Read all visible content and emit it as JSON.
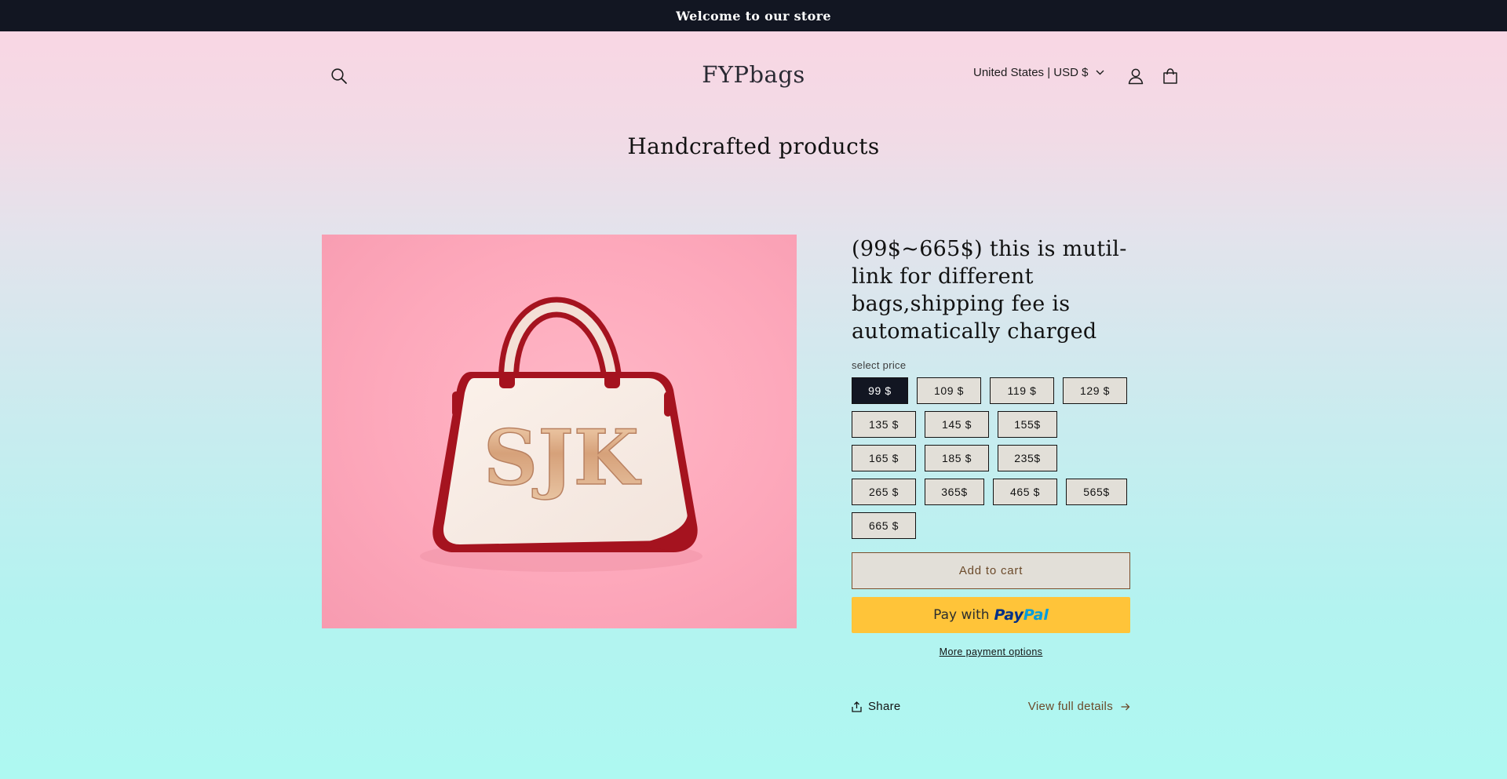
{
  "announcement": {
    "text": "Welcome to our store"
  },
  "header": {
    "logo": "FYPbags",
    "country_selector": "United States | USD $",
    "icons": [
      "search-icon",
      "account-icon",
      "cart-icon"
    ]
  },
  "collection": {
    "title": "Handcrafted products"
  },
  "product": {
    "image": {
      "monogram": "SJK"
    },
    "title": "(99$~665$) this is mutil-link for different bags,shipping fee is automatically charged",
    "option_label": "select price",
    "selected_option": "99 $",
    "option_rows": [
      [
        "99 $",
        "109 $",
        "119 $",
        "129 $"
      ],
      [
        "135 $",
        "145 $",
        "155$"
      ],
      [
        "165 $",
        "185 $",
        "235$"
      ],
      [
        "265 $",
        "365$",
        "465 $",
        "565$"
      ],
      [
        "665 $"
      ]
    ],
    "add_to_cart": "Add to cart",
    "paypal": {
      "prefix": "Pay with",
      "brand_pay": "Pay",
      "brand_pal": "Pal"
    },
    "more_payment": "More payment options",
    "share": "Share",
    "view_details": "View full details"
  },
  "colors": {
    "announcement_bg": "#121622",
    "swatch_bg": "#e2dfd8",
    "swatch_selected_bg": "#121622",
    "accent_brown": "#6b4a2a",
    "paypal_yellow": "#ffc439",
    "bag_red": "#a5131f",
    "page_gradient_top": "#fbd5e3",
    "page_gradient_bottom": "#aef8f1"
  }
}
